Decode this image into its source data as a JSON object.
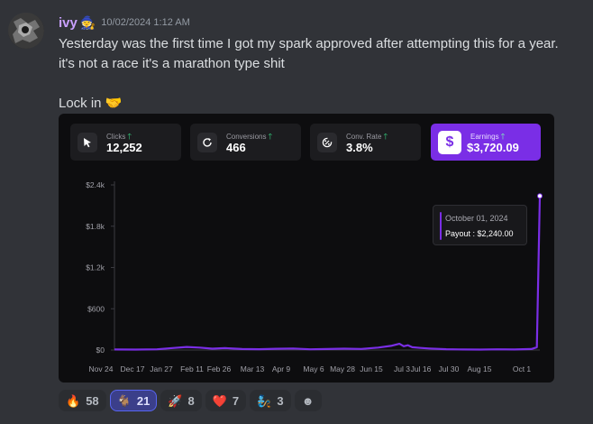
{
  "message": {
    "username": "ivy",
    "role_emoji": "🧙",
    "timestamp": "10/02/2024 1:12 AM",
    "lines": [
      "Yesterday was the first time I got my spark approved after attempting this for a year.",
      "it's not a race it's a marathon type shit",
      "",
      "Lock in 🤝"
    ]
  },
  "embed": {
    "stats": [
      {
        "label": "Clicks",
        "value": "12,252",
        "icon": "cursor-arrow-icon"
      },
      {
        "label": "Conversions",
        "value": "466",
        "icon": "refresh-icon"
      },
      {
        "label": "Conv. Rate",
        "value": "3.8%",
        "icon": "percent-cycle-icon"
      },
      {
        "label": "Earnings",
        "value": "$3,720.09",
        "icon": "dollar-icon"
      }
    ],
    "tooltip": {
      "date": "October 01, 2024",
      "payout": "Payout : $2,240.00"
    }
  },
  "chart_data": {
    "type": "line",
    "title": "",
    "xlabel": "",
    "ylabel": "",
    "y_ticks": [
      "$2.4k",
      "$1.8k",
      "$1.2k",
      "$600",
      "$0"
    ],
    "ylim": [
      0,
      2400
    ],
    "x_ticks": [
      "Nov 24",
      "Dec 17",
      "Jan 27",
      "Feb 11",
      "Feb 26",
      "Mar 13",
      "Apr 9",
      "May 6",
      "May 28",
      "Jun 15",
      "Jul 3",
      "Jul 16",
      "Jul 30",
      "Aug 15",
      "Oct 1"
    ],
    "series": [
      {
        "color": "#7a2ee6",
        "x": [
          0,
          0.05,
          0.1,
          0.14,
          0.17,
          0.2,
          0.23,
          0.26,
          0.3,
          0.34,
          0.38,
          0.42,
          0.46,
          0.5,
          0.54,
          0.58,
          0.62,
          0.65,
          0.67,
          0.68,
          0.69,
          0.7,
          0.72,
          0.74,
          0.78,
          0.82,
          0.86,
          0.9,
          0.94,
          0.98,
          0.993,
          1.0
        ],
        "values": [
          8,
          6,
          10,
          30,
          45,
          35,
          20,
          28,
          15,
          12,
          18,
          22,
          10,
          14,
          20,
          16,
          35,
          60,
          90,
          55,
          70,
          40,
          30,
          22,
          12,
          8,
          6,
          10,
          8,
          15,
          40,
          2240
        ]
      }
    ],
    "grid": false,
    "legend": "none"
  },
  "reactions": [
    {
      "emoji": "🔥",
      "count": "58",
      "active": false
    },
    {
      "emoji": "🐐",
      "count": "21",
      "active": true
    },
    {
      "emoji": "🚀",
      "count": "8",
      "active": false
    },
    {
      "emoji": "❤️",
      "count": "7",
      "active": false
    },
    {
      "emoji": "🧞",
      "count": "3",
      "active": false
    }
  ],
  "add_reaction_icon": "smile-plus-icon",
  "colors": {
    "background": "#313338",
    "username": "#c9a0ff",
    "accent": "#7a2ee6",
    "up_arrow": "#35d07f"
  }
}
